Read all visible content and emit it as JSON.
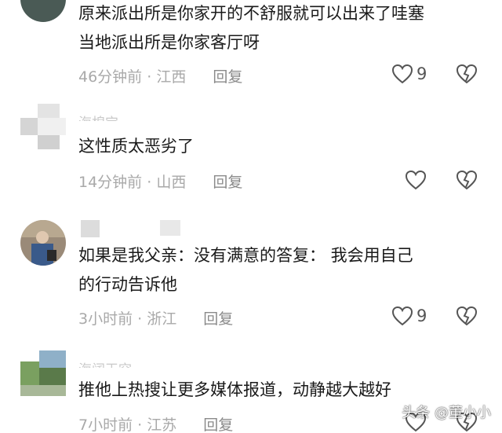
{
  "comments": [
    {
      "username": "",
      "lines": [
        "原来派出所是你家开的不舒服就可以出来了哇塞",
        "当地派出所是你家客厅呀"
      ],
      "time": "46分钟前",
      "location": "江西",
      "reply_label": "回复",
      "likes": "9"
    },
    {
      "username": "海棉宝",
      "lines": [
        "这性质太恶劣了"
      ],
      "time": "14分钟前",
      "location": "山西",
      "reply_label": "回复",
      "likes": ""
    },
    {
      "username": "",
      "lines": [
        "如果是我父亲：没有满意的答复： 我会用自己",
        "的行动告诉他"
      ],
      "time": "3小时前",
      "location": "浙江",
      "reply_label": "回复",
      "likes": "9"
    },
    {
      "username": "海阔天空",
      "lines": [
        "推他上热搜让更多媒体报道，动静越大越好"
      ],
      "time": "7小时前",
      "location": "江苏",
      "reply_label": "回复",
      "likes": ""
    }
  ],
  "separator": " · ",
  "watermark": "头条 @董小小",
  "icons": {
    "like": "heart-outline-icon",
    "dislike": "broken-heart-icon"
  },
  "colors": {
    "text": "#1a1a1a",
    "meta": "#a9a9a9",
    "icon": "#555555"
  }
}
